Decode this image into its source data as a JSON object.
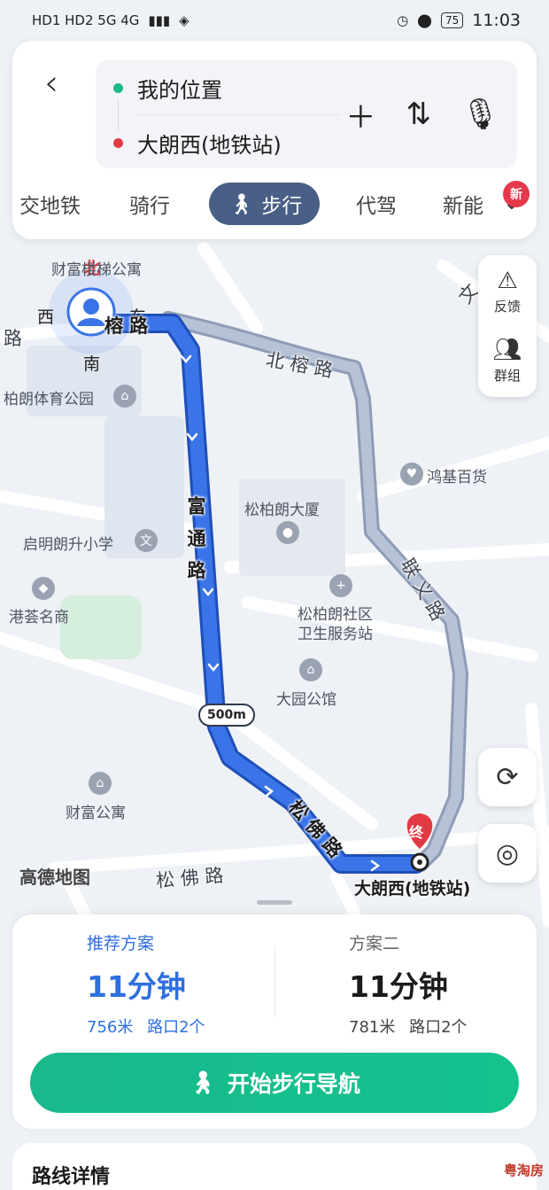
{
  "status_bar": {
    "left": "HD1 HD2 5G 4G",
    "battery": "75",
    "time": "11:03"
  },
  "search": {
    "from": "我的位置",
    "to": "大朗西(地铁站)"
  },
  "tabs": [
    {
      "label": "交地铁"
    },
    {
      "label": "骑行"
    },
    {
      "label": "步行"
    },
    {
      "label": "代驾"
    },
    {
      "label": "新能"
    }
  ],
  "new_badge": "新",
  "side_tools": {
    "feedback": "反馈",
    "group": "群组"
  },
  "map": {
    "compass": {
      "north": "北",
      "south": "南",
      "east": "东",
      "west": "西"
    },
    "roads": {
      "beirong": "北 榕 路",
      "beirong_main": "榕 路",
      "futong": "富 通 路",
      "songfo": "松 佛 路",
      "songfo_gray": "松 佛 路",
      "lianyi": "联 义 路",
      "left": "路",
      "right_top": "文"
    },
    "pois": [
      "财富楼梯公寓",
      "柏朗体育公园",
      "鸿基百货",
      "松柏朗大厦",
      "启明朗升小学",
      "港荟名商",
      "松柏朗社区",
      "卫生服务站",
      "大园公馆",
      "财富公寓"
    ],
    "destination_marker": "终",
    "destination_label": "大朗西(地铁站)",
    "scale": "500m",
    "logo": "高德地图"
  },
  "plans": [
    {
      "name": "推荐方案",
      "time": "11分钟",
      "distance": "756米",
      "crossings": "路口2个"
    },
    {
      "name": "方案二",
      "time": "11分钟",
      "distance": "781米",
      "crossings": "路口2个"
    }
  ],
  "start_button": "开始步行导航",
  "detail_title": "路线详情",
  "watermark": "粤淘房",
  "colors": {
    "route_primary": "#3b74e8",
    "route_alt": "#a9b6cc",
    "start_button": "#19b98c",
    "active_tab": "#4a5f86",
    "recommended_text": "#2e6fe0"
  }
}
